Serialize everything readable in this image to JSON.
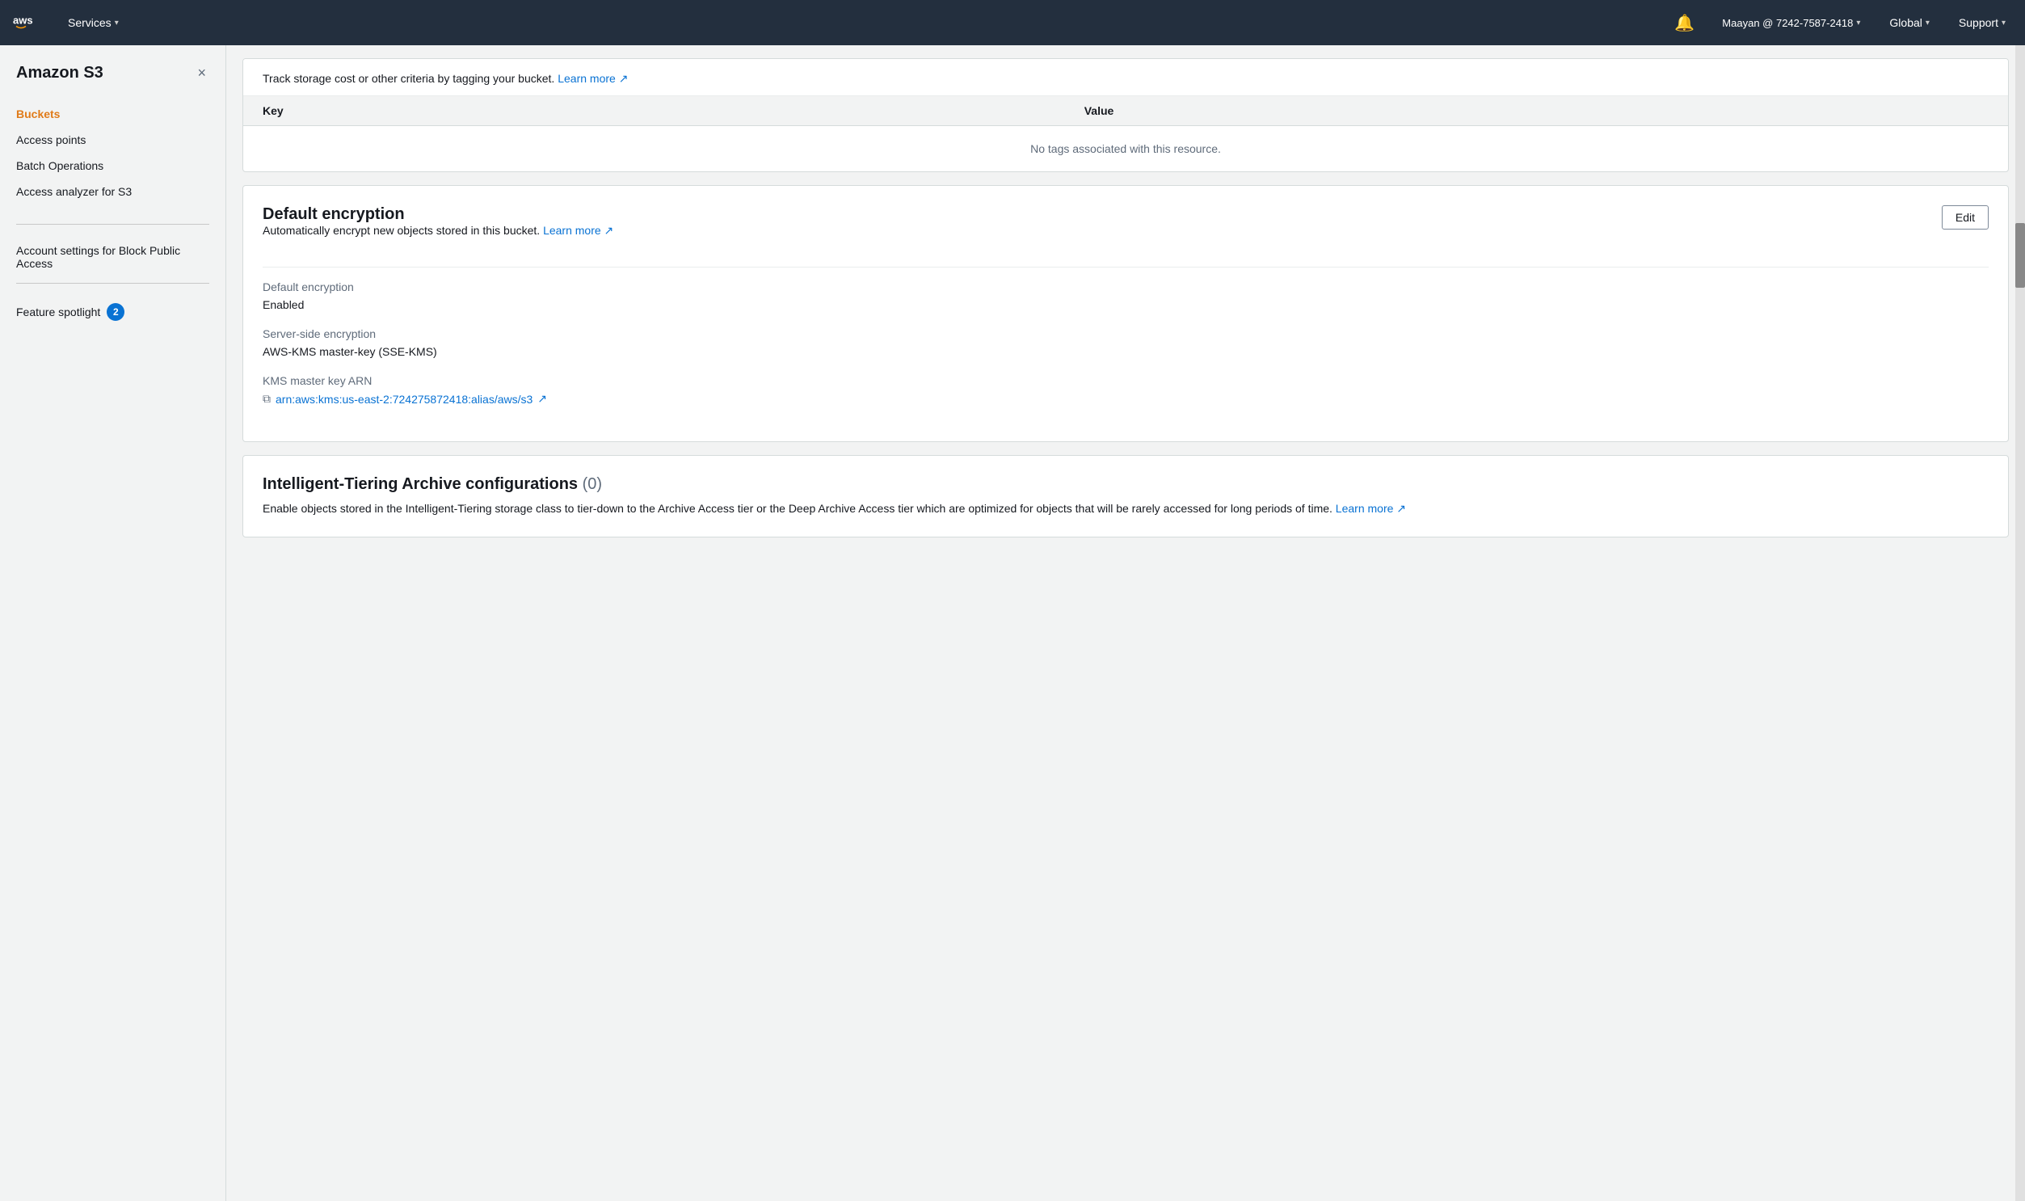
{
  "topnav": {
    "logo": "aws",
    "services_label": "Services",
    "bell_icon": "🔔",
    "user": "Maayan @ 7242-7587-2418",
    "region": "Global",
    "support": "Support"
  },
  "sidebar": {
    "title": "Amazon S3",
    "close_label": "×",
    "nav_items": [
      {
        "label": "Buckets",
        "active": true
      },
      {
        "label": "Access points",
        "active": false
      },
      {
        "label": "Batch Operations",
        "active": false
      },
      {
        "label": "Access analyzer for S3",
        "active": false
      }
    ],
    "section_items": [
      {
        "label": "Account settings for Block Public Access"
      }
    ],
    "feature_spotlight": {
      "label": "Feature spotlight",
      "badge": "2"
    }
  },
  "tags_section": {
    "info_text": "Track storage cost or other criteria by tagging your bucket.",
    "learn_more": "Learn more",
    "col_key": "Key",
    "col_value": "Value",
    "empty_text": "No tags associated with this resource."
  },
  "encryption_section": {
    "title": "Default encryption",
    "subtitle": "Automatically encrypt new objects stored in this bucket.",
    "learn_more": "Learn more",
    "edit_label": "Edit",
    "fields": [
      {
        "label": "Default encryption",
        "value": "Enabled"
      },
      {
        "label": "Server-side encryption",
        "value": "AWS-KMS master-key (SSE-KMS)"
      },
      {
        "label": "KMS master key ARN",
        "value": "arn:aws:kms:us-east-2:724275872418:alias/aws/s3",
        "is_link": true
      }
    ]
  },
  "tiering_section": {
    "title": "Intelligent-Tiering Archive configurations",
    "count": "(0)",
    "description": "Enable objects stored in the Intelligent-Tiering storage class to tier-down to the Archive Access tier or the Deep Archive Access tier which are optimized for objects that will be rarely accessed for long periods of time.",
    "learn_more": "Learn more"
  }
}
